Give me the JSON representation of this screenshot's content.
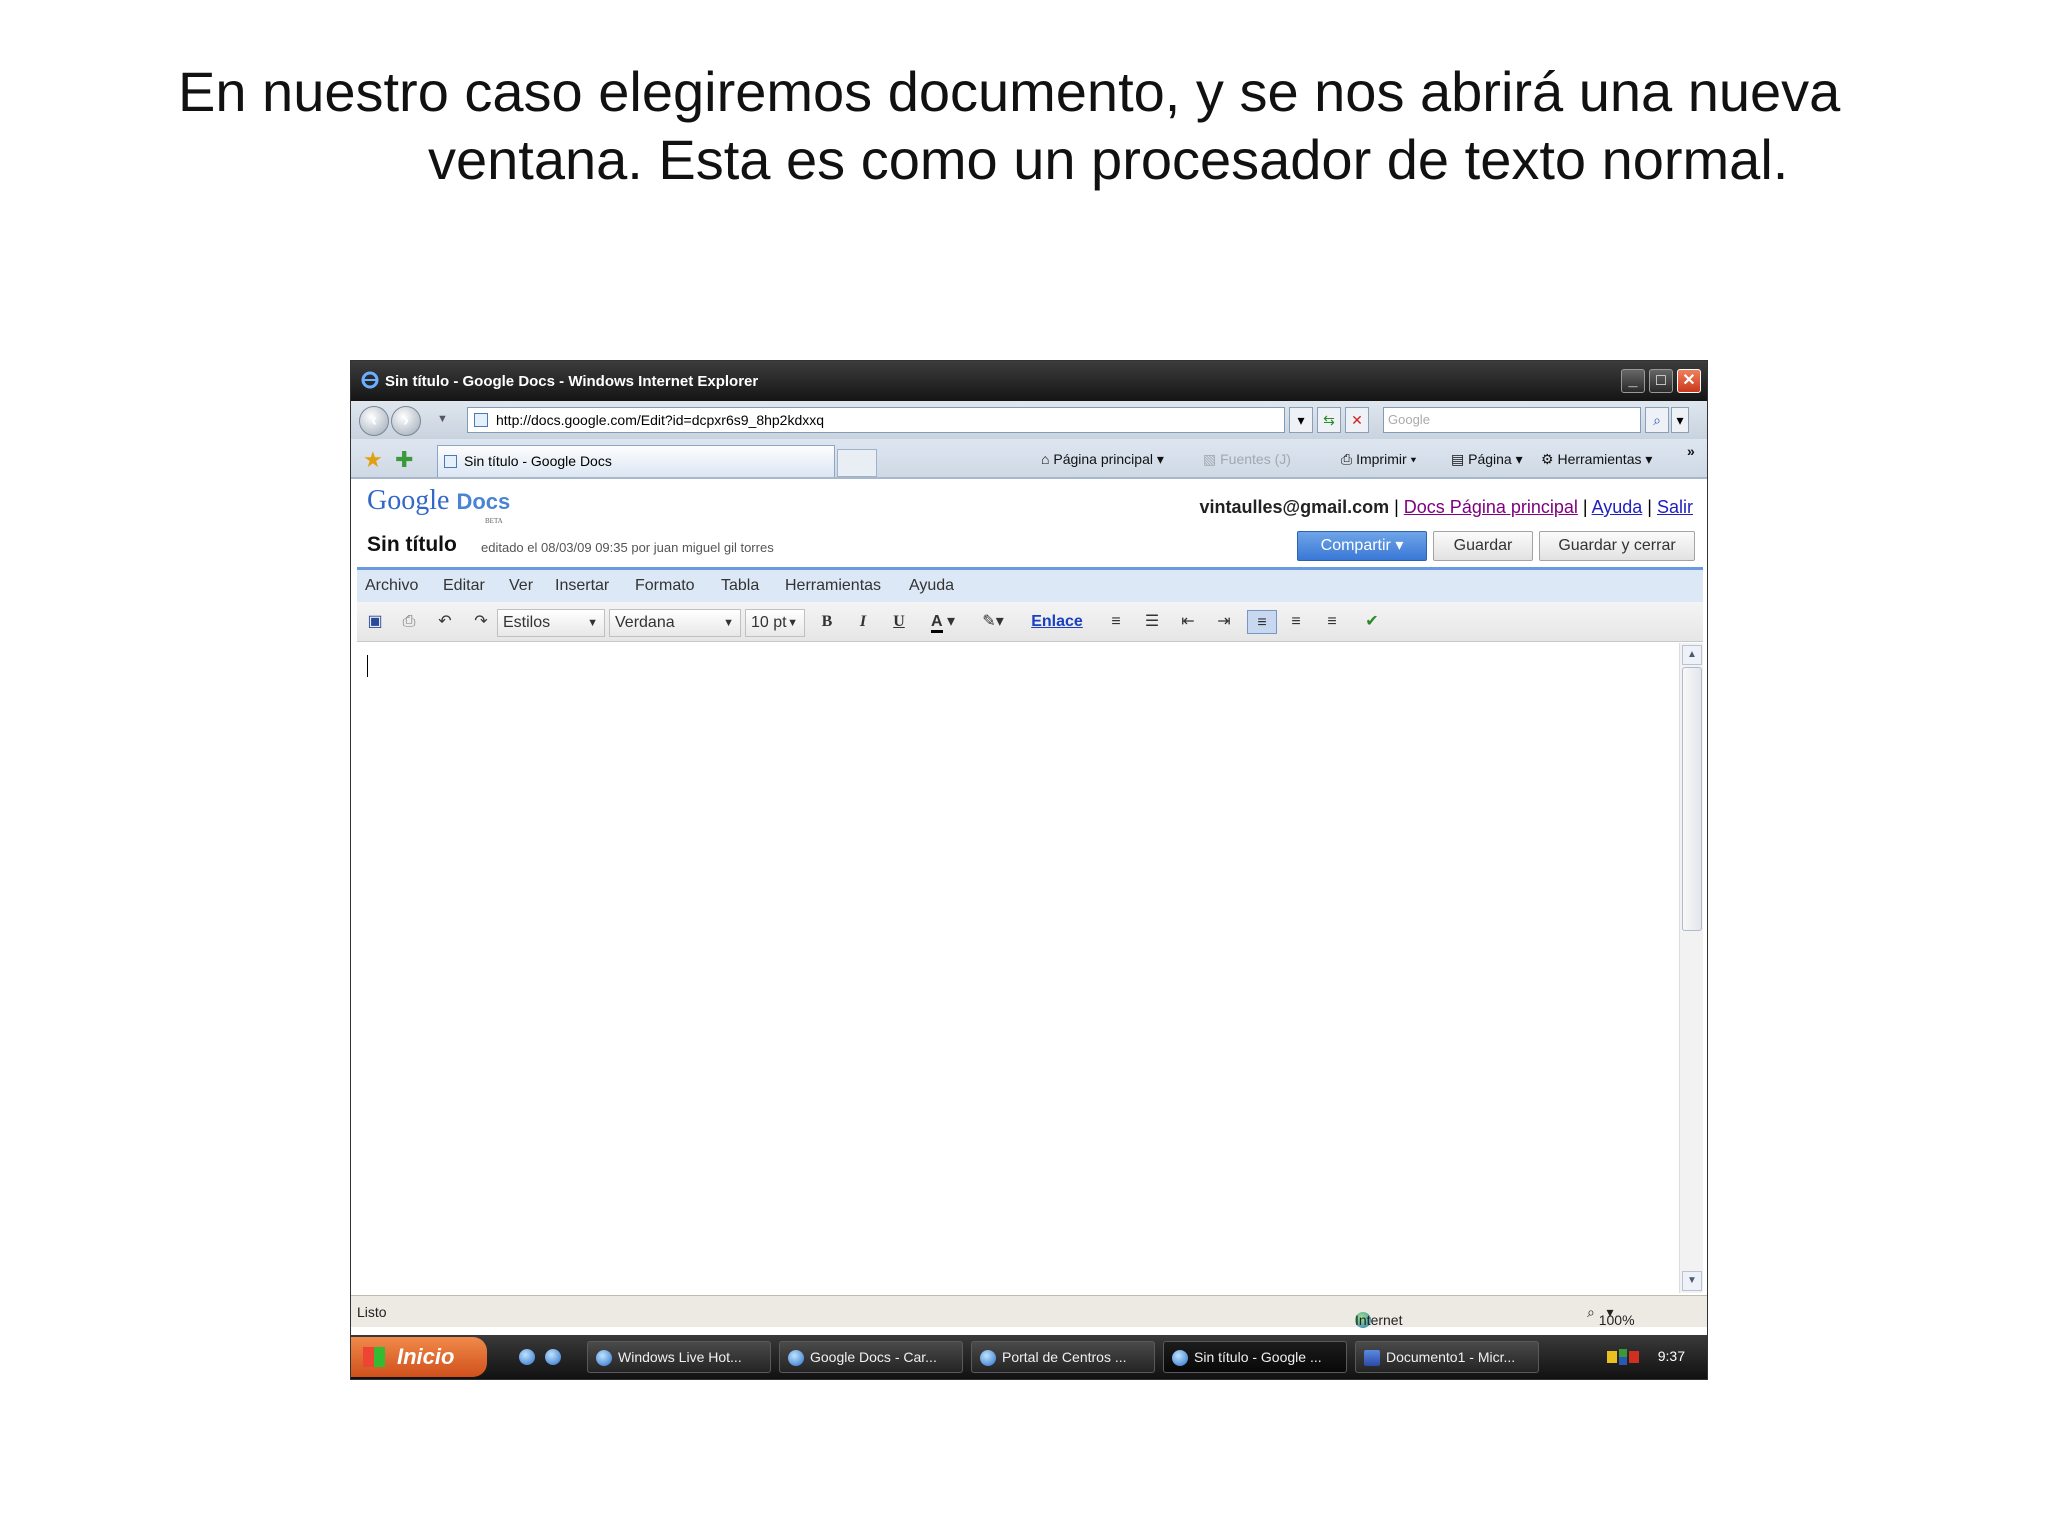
{
  "slide": {
    "line1": "En nuestro caso elegiremos documento, y se nos abrirá una nueva",
    "line2": "ventana. Esta es como un procesador de texto normal."
  },
  "window": {
    "title": "Sin título - Google Docs - Windows Internet Explorer",
    "url": "http://docs.google.com/Edit?id=dcpxr6s9_8hp2kdxxq",
    "search_placeholder": "Google",
    "tab_title": "Sin título - Google Docs",
    "commands": {
      "home": "Página principal",
      "feeds": "Fuentes (J)",
      "print": "Imprimir",
      "page": "Página",
      "tools": "Herramientas"
    }
  },
  "gdocs": {
    "logo_google": "Google",
    "logo_docs": "Docs",
    "logo_beta": "BETA",
    "email": "vintaulles@gmail.com",
    "links": {
      "home": "Docs Página principal",
      "help": "Ayuda",
      "signout": "Salir"
    },
    "doc_title": "Sin título",
    "edited": "editado el 08/03/09 09:35 por juan miguel gil torres",
    "buttons": {
      "share": "Compartir ▾",
      "save": "Guardar",
      "save_close": "Guardar y cerrar"
    },
    "menu": [
      "Archivo",
      "Editar",
      "Ver",
      "Insertar",
      "Formato",
      "Tabla",
      "Herramientas",
      "Ayuda"
    ],
    "toolbar": {
      "styles": "Estilos",
      "font": "Verdana",
      "size": "10 pt",
      "bold": "B",
      "italic": "I",
      "underline": "U",
      "text_color": "A",
      "link": "Enlace"
    }
  },
  "status": {
    "text": "Listo",
    "zone": "Internet",
    "zoom": "100%"
  },
  "taskbar": {
    "start": "Inicio",
    "tasks": [
      "Windows Live Hot...",
      "Google Docs - Car...",
      "Portal de Centros ...",
      "Sin título - Google ...",
      "Documento1 - Micr..."
    ],
    "clock": "9:37"
  }
}
